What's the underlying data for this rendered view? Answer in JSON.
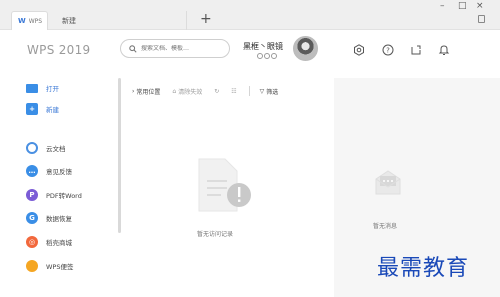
{
  "tabs": [
    {
      "label": "WPS",
      "active": true
    },
    {
      "label": "新建",
      "active": false
    }
  ],
  "window": {
    "new_tab": "+",
    "minimize": "–",
    "maximize": "□",
    "close": "×"
  },
  "brand": "WPS 2019",
  "search": {
    "placeholder": "搜索文档、模板…"
  },
  "user": {
    "name": "黑框丶眼镜"
  },
  "sidebar": {
    "items": [
      {
        "label": "打开",
        "icon": "folder-icon",
        "color": "#3a8ee6"
      },
      {
        "label": "新建",
        "icon": "plus-icon",
        "color": "#3a8ee6"
      },
      {
        "label": "云文档",
        "icon": "cloud-icon",
        "color": "#4a90e2"
      },
      {
        "label": "意见反馈",
        "icon": "chat-icon",
        "color": "#3a8ee6"
      },
      {
        "label": "PDF转Word",
        "icon": "pdf-icon",
        "color": "#7b5cd6"
      },
      {
        "label": "数据恢复",
        "icon": "recover-icon",
        "color": "#3a8ee6"
      },
      {
        "label": "稻壳商城",
        "icon": "store-icon",
        "color": "#f2683c"
      },
      {
        "label": "WPS便签",
        "icon": "note-icon",
        "color": "#f5a623"
      }
    ]
  },
  "toolbar": {
    "location": "常用位置",
    "clear": "清除失效",
    "filter": "筛选"
  },
  "main": {
    "empty_text": "暂无访问记录"
  },
  "right": {
    "empty_text": "暂无消息"
  },
  "watermark": "最需教育"
}
